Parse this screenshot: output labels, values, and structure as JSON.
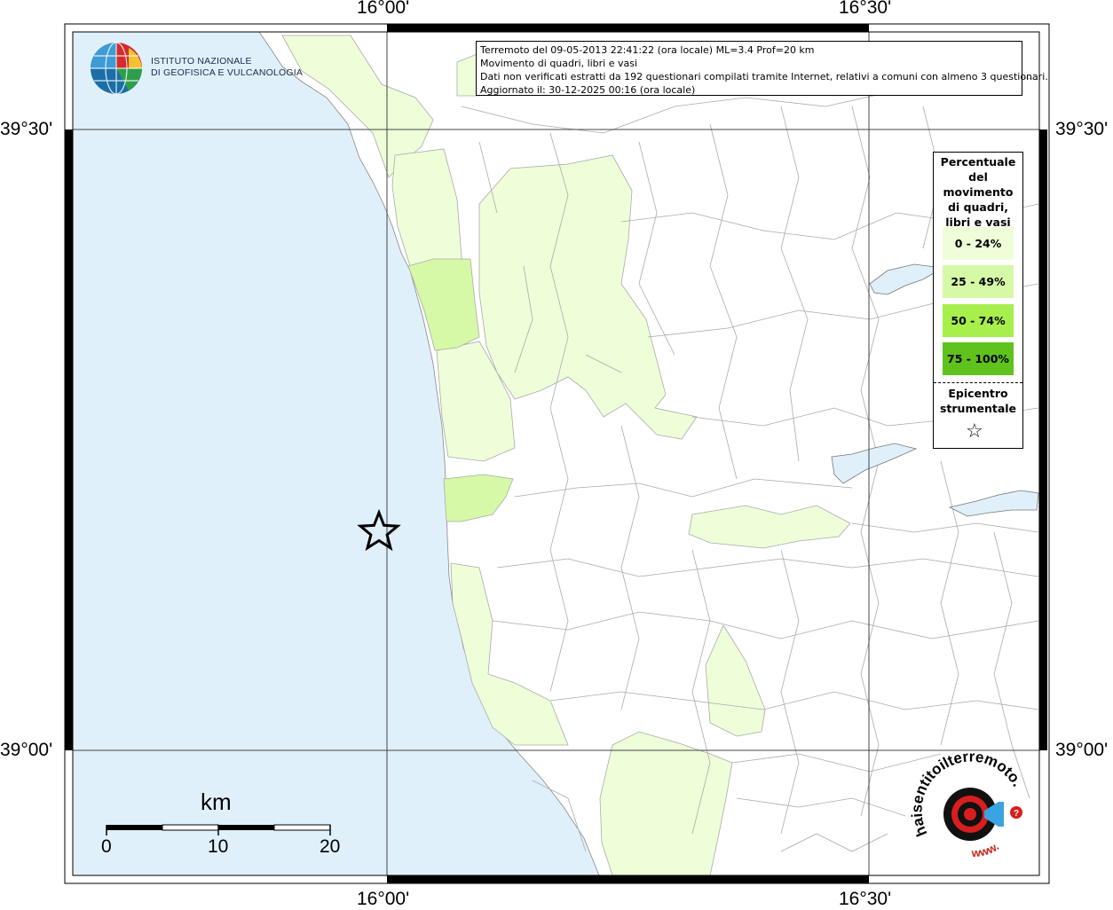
{
  "map": {
    "ticks": {
      "top": [
        "16°00'",
        "16°30'"
      ],
      "bottom": [
        "16°00'",
        "16°30'"
      ],
      "left": [
        "39°30'",
        "39°00'"
      ],
      "right": [
        "39°30'",
        "39°00'"
      ]
    },
    "colors": {
      "sea": "#e0f0fb",
      "land": "#ffffff",
      "class_0_24": "#eefed9",
      "class_25_49": "#d6f9a8",
      "class_50_74": "#a6ef4c",
      "class_75_100": "#5fc21d",
      "borders": "#aaaaaa"
    },
    "epicenter_icon": "star-icon"
  },
  "info": {
    "line1": "Terremoto del 09-05-2013 22:41:22 (ora locale) ML=3.4 Prof=20 km",
    "line2": "Movimento di quadri, libri e vasi",
    "line3": "Dati non verificati estratti da 192 questionari compilati tramite Internet, relativi a comuni con almeno 3 questionari.",
    "line4": "Aggiornato il: 30-12-2025 00:16 (ora locale)"
  },
  "legend": {
    "title": "Percentuale del movimento di quadri, libri e vasi",
    "items": [
      {
        "label": "0 - 24%",
        "color": "#eefed9"
      },
      {
        "label": "25 - 49%",
        "color": "#d6f9a8"
      },
      {
        "label": "50 - 74%",
        "color": "#a6ef4c"
      },
      {
        "label": "75 - 100%",
        "color": "#5fc21d"
      }
    ],
    "epicenter_label": "Epicentro strumentale",
    "epicenter_icon": "star-icon"
  },
  "logos": {
    "ingv_line1": "ISTITUTO NAZIONALE",
    "ingv_line2": "DI GEOFISICA E VULCANOLOGIA",
    "hst_text": "haisentitoilterremoto.it",
    "hst_www": "www."
  },
  "scale": {
    "unit": "km",
    "labels": [
      "0",
      "10",
      "20"
    ]
  }
}
